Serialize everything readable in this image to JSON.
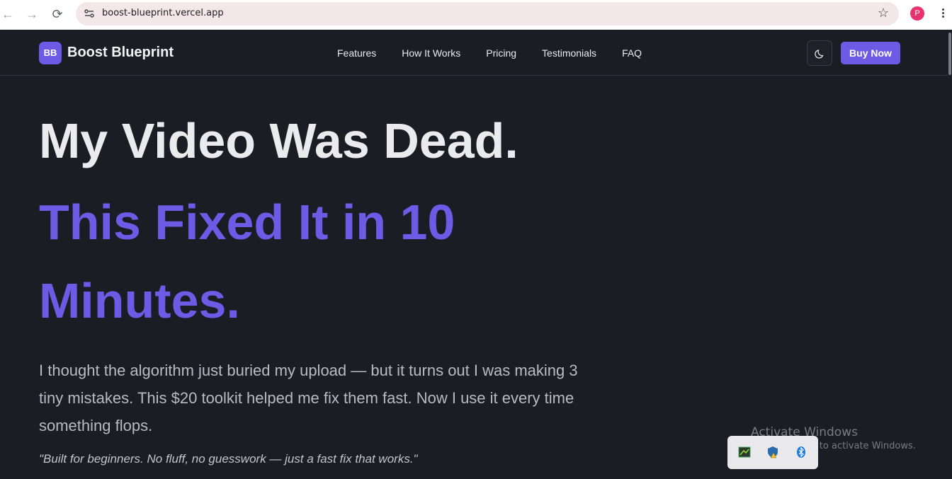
{
  "browser": {
    "url": "boost-blueprint.vercel.app",
    "profile_initial": "P"
  },
  "header": {
    "logo_badge": "BB",
    "brand": "Boost Blueprint",
    "nav": [
      "Features",
      "How It Works",
      "Pricing",
      "Testimonials",
      "FAQ"
    ],
    "buy_label": "Buy Now"
  },
  "hero": {
    "headline_line1": "My Video Was Dead.",
    "headline_line2": "This Fixed It in 10",
    "headline_line3": "Minutes.",
    "lead": "I thought the algorithm just buried my upload — but it turns out I was making 3 tiny mistakes. This $20 toolkit helped me fix them fast. Now I use it every time something flops.",
    "quote": "\"Built for beginners. No fluff, no guesswork — just a fast fix that works.\""
  },
  "os_overlay": {
    "activate_title": "Activate Windows",
    "activate_sub": "Go to Settings to activate Windows."
  },
  "colors": {
    "accent": "#6f5ae6",
    "background": "#1b1c24"
  }
}
